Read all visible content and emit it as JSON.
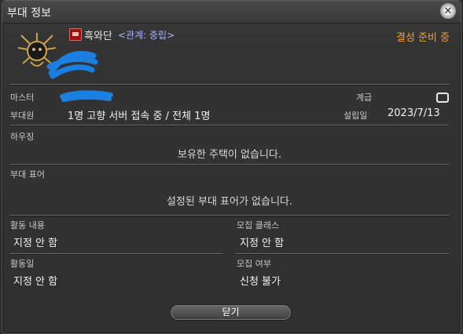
{
  "window": {
    "title": "부대 정보"
  },
  "company": {
    "name": "흑와단",
    "relation": "<관계: 중립>",
    "status": "결성 준비 중"
  },
  "info": {
    "master_label": "마스터",
    "rank_label": "계급",
    "members_label": "부대원",
    "members_value": "1명 고향 서버 접속 중 / 전체 1명",
    "founded_label": "설립일",
    "founded_value": "2023/7/13"
  },
  "housing": {
    "label": "하우징",
    "value": "보유한 주택이 없습니다."
  },
  "slogan": {
    "label": "부대 표어",
    "value": "설정된 부대 표어가 없습니다."
  },
  "activity": {
    "label": "활동 내용",
    "value": "지정 안 함"
  },
  "recruit_class": {
    "label": "모집 클래스",
    "value": "지정 안 함"
  },
  "active_days": {
    "label": "활동일",
    "value": "지정 안 함"
  },
  "recruiting": {
    "label": "모집 여부",
    "value": "신청 불가"
  },
  "buttons": {
    "close": "닫기"
  },
  "colors": {
    "status": "#f0a030",
    "relation": "#a6b3ff",
    "redaction": "#1a7fe0"
  }
}
